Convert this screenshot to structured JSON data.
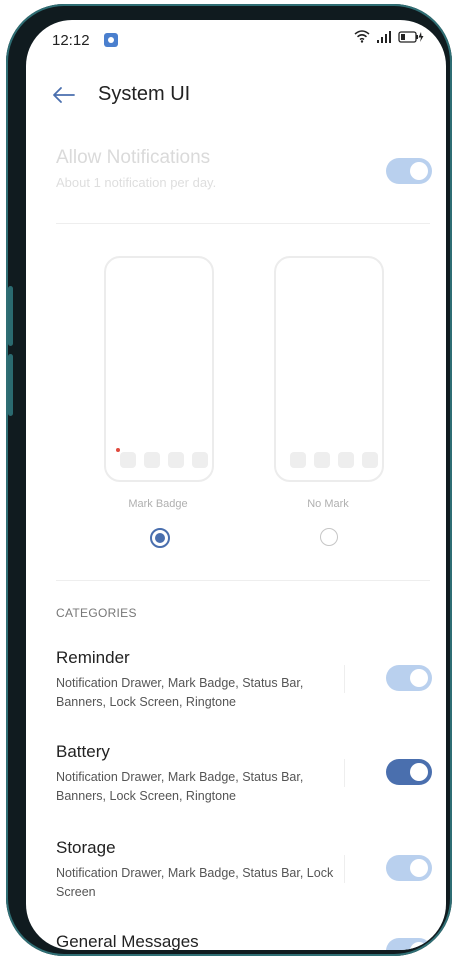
{
  "status_bar": {
    "time": "12:12",
    "icons": [
      "app-notification-icon",
      "wifi-icon",
      "signal-icon",
      "battery-charging-icon"
    ]
  },
  "header": {
    "back_icon": "arrow-left-icon",
    "title": "System UI"
  },
  "allow_notifications": {
    "title": "Allow Notifications",
    "subtitle": "About 1 notification per day.",
    "enabled": true,
    "disabled_state": true
  },
  "badge_options": [
    {
      "label": "Mark Badge",
      "selected": true
    },
    {
      "label": "No Mark",
      "selected": false
    }
  ],
  "categories_header": "CATEGORIES",
  "categories": [
    {
      "title": "Reminder",
      "subtitle": "Notification Drawer, Mark Badge, Status Bar, Banners, Lock Screen, Ringtone",
      "toggle": "disabled-on"
    },
    {
      "title": "Battery",
      "subtitle": "Notification Drawer, Mark Badge, Status Bar, Banners, Lock Screen, Ringtone",
      "toggle": "on"
    },
    {
      "title": "Storage",
      "subtitle": "Notification Drawer, Mark Badge, Status Bar, Lock Screen",
      "toggle": "disabled-on"
    },
    {
      "title": "General Messages",
      "subtitle": "",
      "toggle": "disabled-on"
    }
  ],
  "colors": {
    "accent": "#4a6fae",
    "disabled_toggle": "#b9d0ee",
    "badge_dot": "#e04a3e"
  }
}
